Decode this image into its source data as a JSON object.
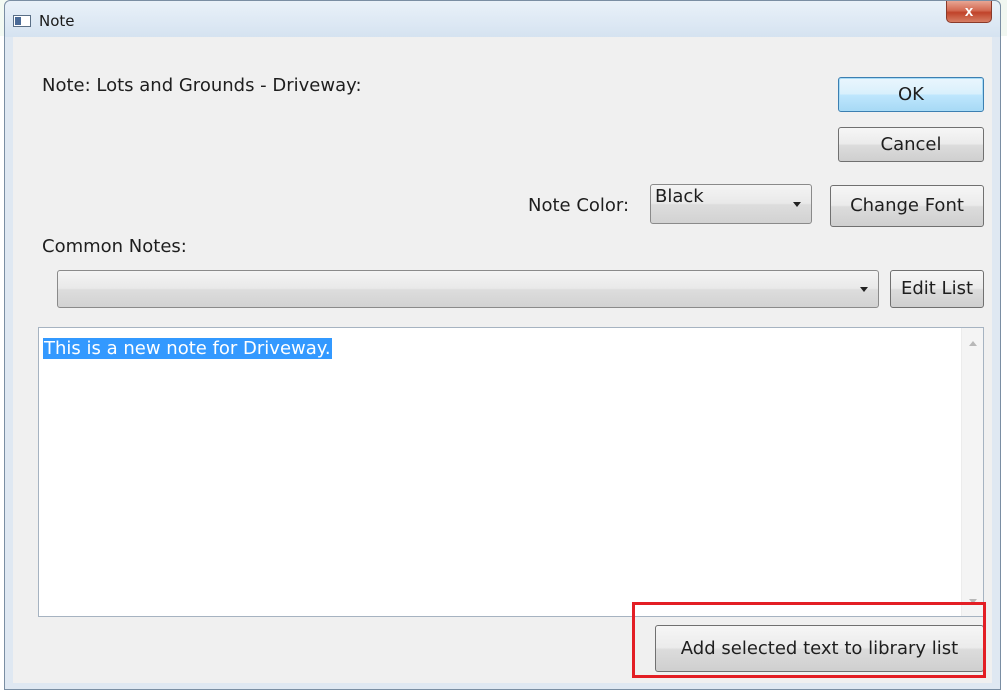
{
  "window": {
    "title": "Note",
    "close_symbol": "x",
    "icon": "window-app-icon"
  },
  "header": {
    "note_label": "Note: Lots and Grounds - Driveway:"
  },
  "buttons": {
    "ok": "OK",
    "cancel": "Cancel",
    "change_font": "Change Font",
    "edit_list": "Edit List",
    "add_selected": "Add selected text to library list"
  },
  "note_color": {
    "label": "Note Color:",
    "selected": "Black"
  },
  "common_notes": {
    "label": "Common Notes:",
    "selected": ""
  },
  "editor": {
    "text": "This is a new note for Driveway."
  },
  "colors": {
    "selection": "#3399ff",
    "highlight_box": "#e31e24",
    "default_button": "#bee6fd"
  }
}
